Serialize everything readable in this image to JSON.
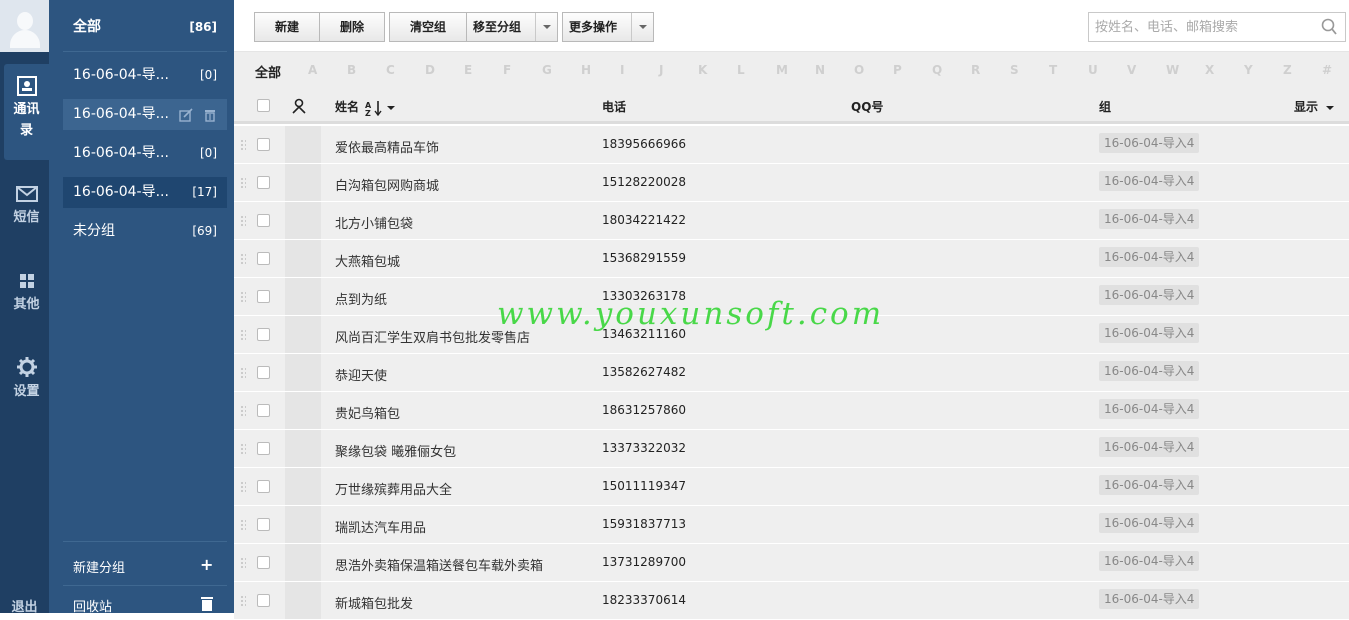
{
  "nav": {
    "items": [
      {
        "label": "通讯录",
        "icon": "contact-card-icon"
      },
      {
        "label": "短信",
        "icon": "envelope-icon"
      },
      {
        "label": "其他",
        "icon": "grid-icon"
      },
      {
        "label": "设置",
        "icon": "gear-icon"
      }
    ],
    "exit_label": "退出"
  },
  "groups": {
    "all": {
      "label": "全部",
      "count": "[86]"
    },
    "items": [
      {
        "label": "16-06-04-导...",
        "count": "[0]"
      },
      {
        "label": "16-06-04-导...",
        "count": ""
      },
      {
        "label": "16-06-04-导...",
        "count": "[0]"
      },
      {
        "label": "16-06-04-导...",
        "count": "[17]"
      },
      {
        "label": "未分组",
        "count": "[69]"
      }
    ],
    "new_group": "新建分组",
    "recycle": "回收站"
  },
  "toolbar": {
    "new_label": "新建",
    "delete_label": "删除",
    "clear_group_label": "清空组",
    "move_to_group_label": "移至分组",
    "more_ops_label": "更多操作"
  },
  "search": {
    "placeholder": "按姓名、电话、邮箱搜索",
    "value": ""
  },
  "alpha_filter": {
    "all": "全部",
    "letters": [
      "A",
      "B",
      "C",
      "D",
      "E",
      "F",
      "G",
      "H",
      "I",
      "J",
      "K",
      "L",
      "M",
      "N",
      "O",
      "P",
      "Q",
      "R",
      "S",
      "T",
      "U",
      "V",
      "W",
      "X",
      "Y",
      "Z",
      "#"
    ]
  },
  "table": {
    "columns": {
      "name": "姓名",
      "phone": "电话",
      "qq": "QQ号",
      "group": "组",
      "display": "显示"
    },
    "rows": [
      {
        "name": "爱依最高精品车饰",
        "phone": "18395666966",
        "qq": "",
        "group": "16-06-04-导入4"
      },
      {
        "name": "白沟箱包网购商城",
        "phone": "15128220028",
        "qq": "",
        "group": "16-06-04-导入4"
      },
      {
        "name": "北方小铺包袋",
        "phone": "18034221422",
        "qq": "",
        "group": "16-06-04-导入4"
      },
      {
        "name": "大燕箱包城",
        "phone": "15368291559",
        "qq": "",
        "group": "16-06-04-导入4"
      },
      {
        "name": "点到为纸",
        "phone": "13303263178",
        "qq": "",
        "group": "16-06-04-导入4"
      },
      {
        "name": "风尚百汇学生双肩书包批发零售店",
        "phone": "13463211160",
        "qq": "",
        "group": "16-06-04-导入4"
      },
      {
        "name": "恭迎天使",
        "phone": "13582627482",
        "qq": "",
        "group": "16-06-04-导入4"
      },
      {
        "name": "贵妃鸟箱包",
        "phone": "18631257860",
        "qq": "",
        "group": "16-06-04-导入4"
      },
      {
        "name": "聚缘包袋 曦雅俪女包",
        "phone": "13373322032",
        "qq": "",
        "group": "16-06-04-导入4"
      },
      {
        "name": "万世缘殡葬用品大全",
        "phone": "15011119347",
        "qq": "",
        "group": "16-06-04-导入4"
      },
      {
        "name": "瑞凯达汽车用品",
        "phone": "15931837713",
        "qq": "",
        "group": "16-06-04-导入4"
      },
      {
        "name": "思浩外卖箱保温箱送餐包车载外卖箱",
        "phone": "13731289700",
        "qq": "",
        "group": "16-06-04-导入4"
      },
      {
        "name": "新城箱包批发",
        "phone": "18233370614",
        "qq": "",
        "group": "16-06-04-导入4"
      }
    ]
  },
  "watermark": "www.youxunsoft.com"
}
